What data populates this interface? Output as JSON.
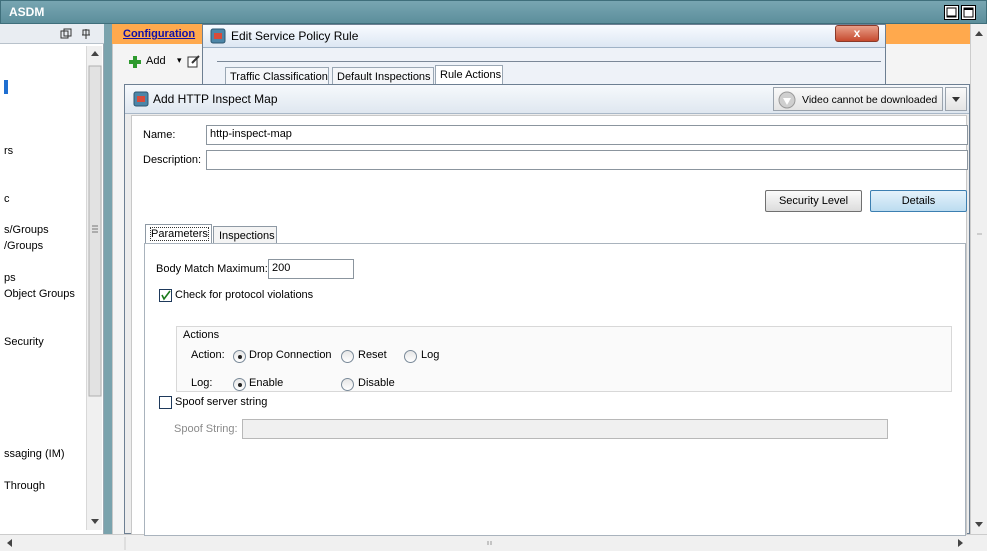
{
  "app": {
    "title": "ASDM"
  },
  "left_nav": {
    "items": [
      "",
      "rs",
      "c",
      "s/Groups",
      "/Groups",
      "ps",
      "Object Groups",
      "Security",
      "ssaging (IM)",
      "Through"
    ]
  },
  "config": {
    "label": "Configuration"
  },
  "toolbar": {
    "add_label": "Add"
  },
  "edit_dialog": {
    "title": "Edit Service Policy Rule",
    "close_label": "x",
    "tabs": [
      "Traffic Classification",
      "Default Inspections",
      "Rule Actions"
    ]
  },
  "http_dialog": {
    "title": "Add HTTP Inspect Map",
    "video_notice": "Video cannot be downloaded",
    "name_label": "Name:",
    "name_value": "http-inspect-map",
    "description_label": "Description:",
    "description_value": "",
    "security_level_label": "Security Level",
    "details_label": "Details",
    "tabs": [
      "Parameters",
      "Inspections"
    ],
    "body_match_label": "Body Match Maximum:",
    "body_match_value": "200",
    "protocol_violations_label": "Check for protocol violations",
    "protocol_violations_checked": true,
    "actions_group_label": "Actions",
    "action_label": "Action:",
    "action_options": [
      "Drop Connection",
      "Reset",
      "Log"
    ],
    "action_selected": "Drop Connection",
    "log_label": "Log:",
    "log_options": [
      "Enable",
      "Disable"
    ],
    "log_selected": "Enable",
    "spoof_server_label": "Spoof server string",
    "spoof_server_checked": false,
    "spoof_string_label": "Spoof String:",
    "spoof_string_value": ""
  },
  "colors": {
    "config_header": "#ffa94d",
    "title_bar": "#5c8e9b",
    "primary_button": "#bcdcf0"
  }
}
